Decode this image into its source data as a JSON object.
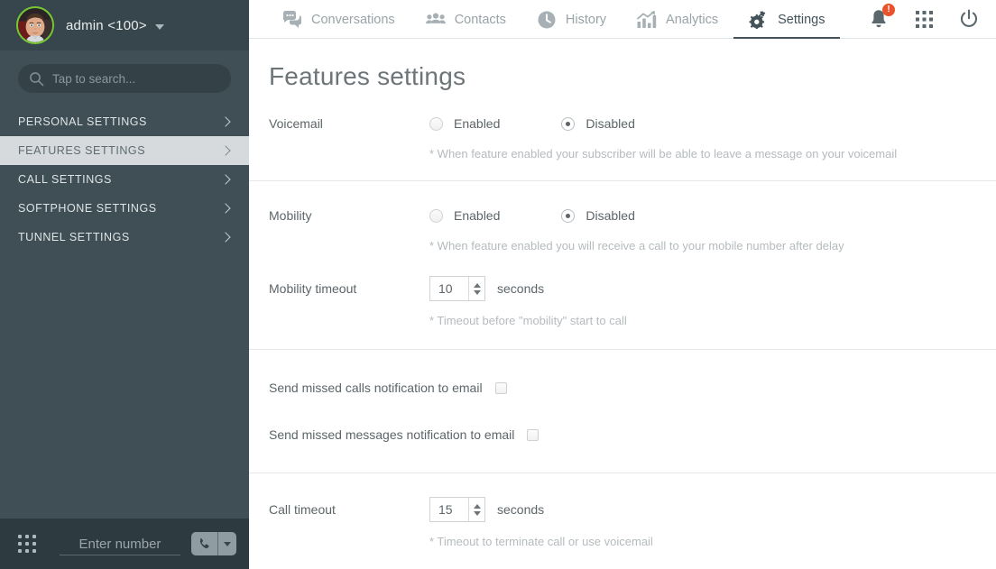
{
  "sidebar": {
    "user": {
      "name": "admin <100>",
      "status_color": "#78c832"
    },
    "search": {
      "placeholder": "Tap to search..."
    },
    "menu": [
      {
        "label": "PERSONAL SETTINGS",
        "active": false
      },
      {
        "label": "FEATURES SETTINGS",
        "active": true
      },
      {
        "label": "CALL SETTINGS",
        "active": false
      },
      {
        "label": "SOFTPHONE SETTINGS",
        "active": false
      },
      {
        "label": "TUNNEL SETTINGS",
        "active": false
      }
    ],
    "dialer": {
      "placeholder": "Enter number"
    }
  },
  "topnav": {
    "tabs": [
      {
        "label": "Conversations",
        "icon": "chat-icon",
        "active": false
      },
      {
        "label": "Contacts",
        "icon": "contacts-icon",
        "active": false
      },
      {
        "label": "History",
        "icon": "clock-icon",
        "active": false
      },
      {
        "label": "Analytics",
        "icon": "chart-icon",
        "active": false
      },
      {
        "label": "Settings",
        "icon": "gear-icon",
        "active": true
      }
    ],
    "notifications": {
      "icon": "bell-icon",
      "badge": "!",
      "badge_color": "#e8532b"
    },
    "apps": {
      "icon": "apps-grid-icon"
    },
    "power": {
      "icon": "power-icon"
    }
  },
  "page": {
    "title": "Features settings",
    "sections": {
      "voicemail": {
        "label": "Voicemail",
        "options": [
          {
            "label": "Enabled",
            "selected": false
          },
          {
            "label": "Disabled",
            "selected": true
          }
        ],
        "hint": "* When feature enabled your subscriber will be able to leave a message on your voicemail"
      },
      "mobility": {
        "label": "Mobility",
        "options": [
          {
            "label": "Enabled",
            "selected": false
          },
          {
            "label": "Disabled",
            "selected": true
          }
        ],
        "hint": "* When feature enabled you will receive a call to your mobile number after delay"
      },
      "mobility_timeout": {
        "label": "Mobility timeout",
        "value": "10",
        "unit": "seconds",
        "hint": "* Timeout before \"mobility\" start to call"
      },
      "missed_calls": {
        "label": "Send missed calls notification to email",
        "checked": false
      },
      "missed_messages": {
        "label": "Send missed messages notification to email",
        "checked": false
      },
      "call_timeout": {
        "label": "Call timeout",
        "value": "15",
        "unit": "seconds",
        "hint": "* Timeout to terminate call or use voicemail"
      }
    }
  }
}
